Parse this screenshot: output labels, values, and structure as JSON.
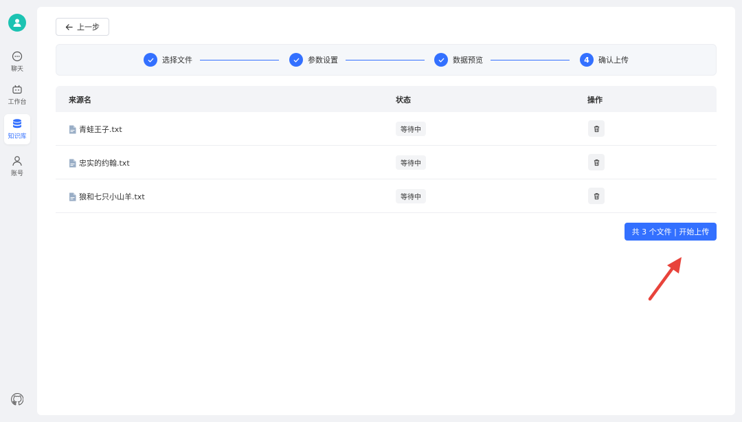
{
  "sidebar": {
    "items": [
      {
        "label": "聊天",
        "icon": "chat-icon",
        "active": false
      },
      {
        "label": "工作台",
        "icon": "robot-icon",
        "active": false
      },
      {
        "label": "知识库",
        "icon": "database-icon",
        "active": true
      },
      {
        "label": "账号",
        "icon": "user-icon",
        "active": false
      }
    ],
    "footer_icon": "github-icon"
  },
  "toolbar": {
    "back_label": "上一步"
  },
  "steps": [
    {
      "label": "选择文件",
      "state": "done"
    },
    {
      "label": "参数设置",
      "state": "done"
    },
    {
      "label": "数据预览",
      "state": "done"
    },
    {
      "label": "确认上传",
      "number": "4",
      "state": "current"
    }
  ],
  "table": {
    "columns": [
      "来源名",
      "状态",
      "操作"
    ],
    "rows": [
      {
        "name": "青蛙王子.txt",
        "status": "等待中"
      },
      {
        "name": "忠实的约翰.txt",
        "status": "等待中"
      },
      {
        "name": "狼和七只小山羊.txt",
        "status": "等待中"
      }
    ]
  },
  "upload_button": {
    "label": "共 3 个文件 | 开始上传"
  },
  "colors": {
    "accent": "#3370ff",
    "avatar": "#1cc3b2",
    "arrow": "#e8433b"
  }
}
